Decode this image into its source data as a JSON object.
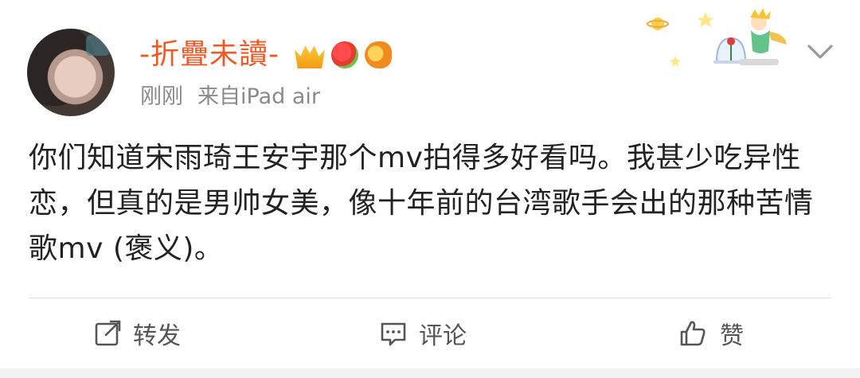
{
  "post": {
    "username": "-折疊未讀-",
    "time": "刚刚",
    "source": "来自iPad air",
    "text": "你们知道宋雨琦王安宇那个mv拍得多好看吗。我甚少吃异性恋，但真的是男帅女美，像十年前的台湾歌手会出的那种苦情歌mv (褒义)。"
  },
  "actions": {
    "repost_label": "转发",
    "comment_label": "评论",
    "like_label": "赞"
  },
  "icons": {
    "repost": "repost-icon",
    "comment": "comment-icon",
    "like": "like-icon",
    "more": "chevron-down-icon"
  },
  "colors": {
    "username": "#f15a24",
    "meta": "#8a8a8a",
    "text": "#222222",
    "action": "#555555"
  }
}
